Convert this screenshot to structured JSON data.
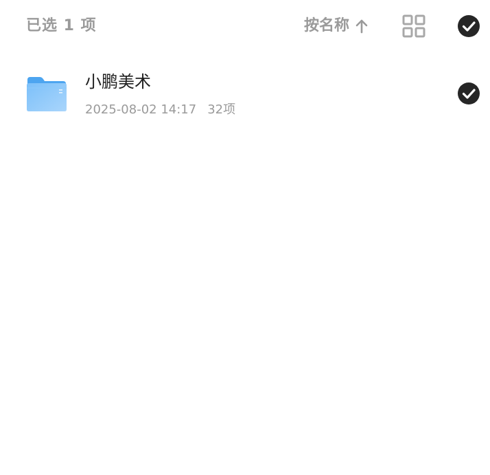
{
  "header": {
    "selected_text": "已选 1 项",
    "sort_label": "按名称",
    "sort_direction_icon": "arrow-up-icon",
    "view_toggle_icon": "grid-view-icon",
    "select_all_icon": "check-circle-icon",
    "select_all_checked": true
  },
  "files": [
    {
      "name": "小鹏美术",
      "date": "2025-08-02 14:17",
      "count": "32项",
      "type_icon": "folder-icon",
      "checked": true
    }
  ],
  "colors": {
    "muted_text": "#9a9a9a",
    "primary_text": "#1f1f1f",
    "check_fill": "#262626",
    "folder_blue": "#5aaef5",
    "grid_icon": "#a8a8a8"
  }
}
